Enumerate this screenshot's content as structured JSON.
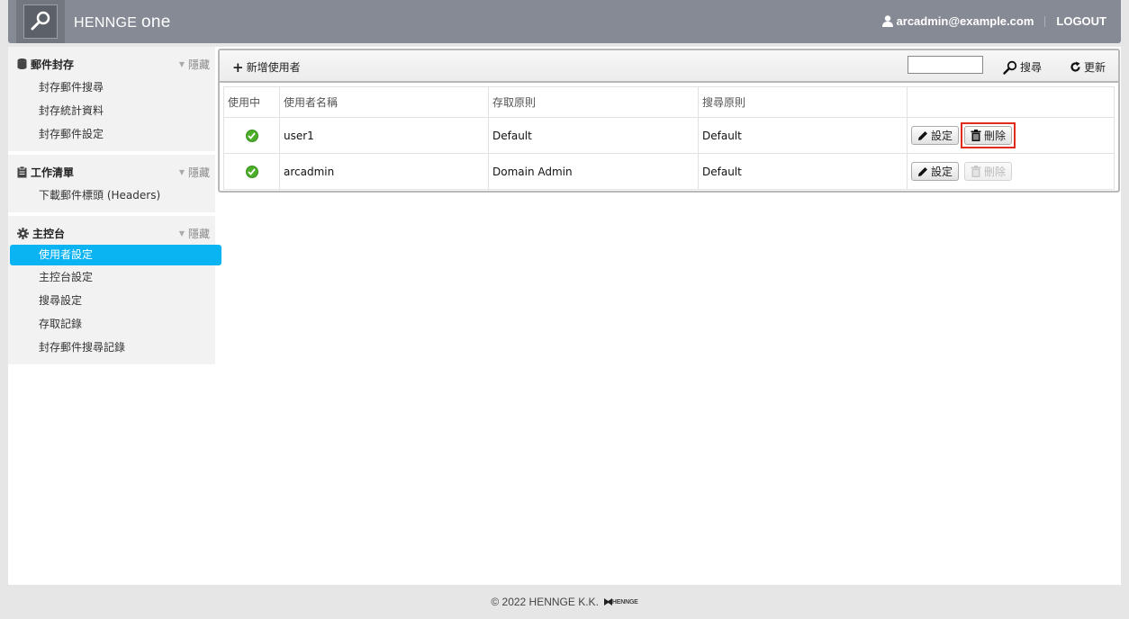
{
  "header": {
    "brand_main": "HENNGE ",
    "brand_one": "one",
    "user_email": "arcadmin@example.com",
    "logout_label": "LOGOUT"
  },
  "sidebar": {
    "sections": [
      {
        "title": "郵件封存",
        "hide_label": "隱藏",
        "items": [
          "封存郵件搜尋",
          "封存統計資料",
          "封存郵件設定"
        ]
      },
      {
        "title": "工作清單",
        "hide_label": "隱藏",
        "items": [
          "下載郵件標頭 (Headers)"
        ]
      },
      {
        "title": "主控台",
        "hide_label": "隱藏",
        "items": [
          "使用者設定",
          "主控台設定",
          "搜尋設定",
          "存取記錄",
          "封存郵件搜尋記錄"
        ],
        "active_index": 0
      }
    ]
  },
  "toolbar": {
    "add_user_label": "新增使用者",
    "search_value": "",
    "search_label": "搜尋",
    "refresh_label": "更新"
  },
  "table": {
    "headers": [
      "使用中",
      "使用者名稱",
      "存取原則",
      "搜尋原則",
      ""
    ],
    "rows": [
      {
        "active": true,
        "name": "user1",
        "access_policy": "Default",
        "search_policy": "Default",
        "settings_label": "設定",
        "delete_label": "刪除",
        "delete_enabled": true
      },
      {
        "active": true,
        "name": "arcadmin",
        "access_policy": "Domain Admin",
        "search_policy": "Default",
        "settings_label": "設定",
        "delete_label": "刪除",
        "delete_enabled": false
      }
    ]
  },
  "footer": {
    "copyright": "© 2022 HENNGE K.K.",
    "logo_text": "HENNGE"
  },
  "colors": {
    "header_bg": "#868a95",
    "active_item": "#0ab4f2",
    "highlight": "#e02b1a",
    "check_green": "#4caf2a"
  }
}
